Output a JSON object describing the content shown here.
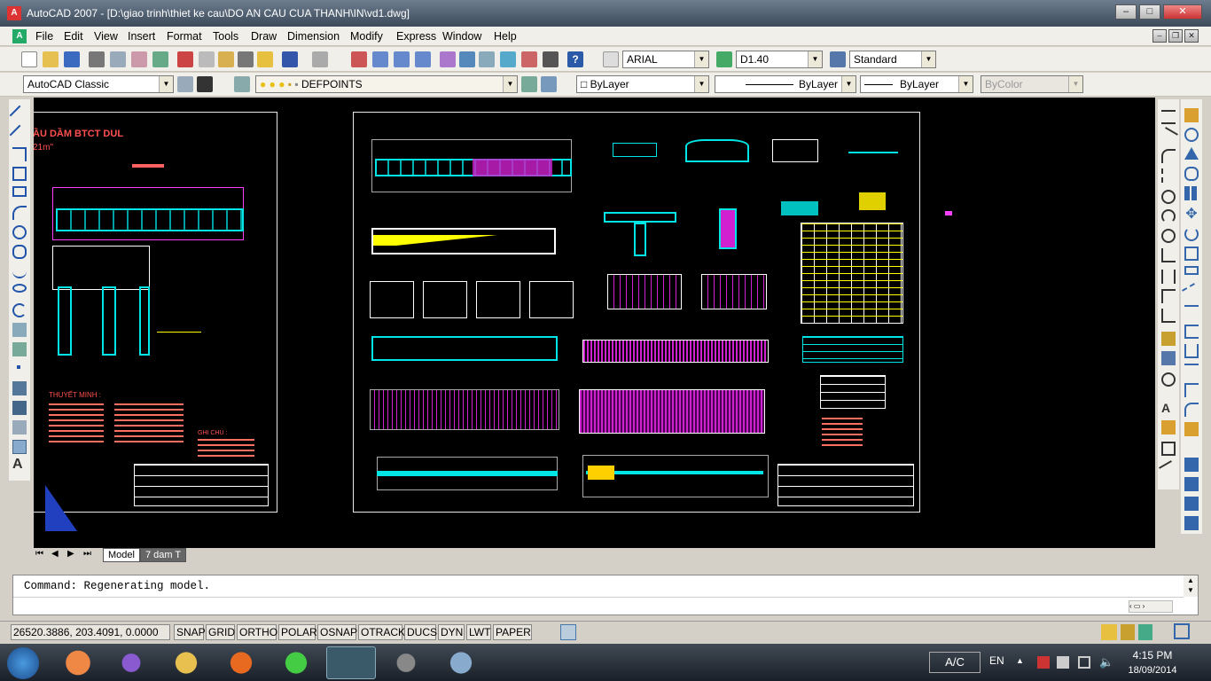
{
  "window": {
    "title": "AutoCAD 2007 - [D:\\giao trinh\\thiet ke cau\\DO AN CAU CUA THANH\\IN\\vd1.dwg]",
    "controls": {
      "minimize": "–",
      "maximize": "□",
      "close": "✕"
    }
  },
  "menu": [
    "File",
    "Edit",
    "View",
    "Insert",
    "Format",
    "Tools",
    "Draw",
    "Dimension",
    "Modify",
    "Express",
    "Window",
    "Help"
  ],
  "toolbar": {
    "text_style": "ARIAL",
    "dim_style": "D1.40",
    "table_style": "Standard",
    "workspace": "AutoCAD Classic",
    "layer": "DEFPOINTS",
    "color": "ByLayer",
    "linetype": "ByLayer",
    "lineweight": "ByLayer",
    "plotstyle": "ByColor"
  },
  "drawing": {
    "left_title": "ẦU DẦM BTCT DUL",
    "left_subtitle": "21m\"",
    "left_note1": "THUYẾT MINH :",
    "left_note2": "GHI CHÚ :"
  },
  "tabs": {
    "model": "Model",
    "layout": "7 dam T"
  },
  "command": {
    "line": "Command: Regenerating model."
  },
  "status": {
    "coords": "26520.3886, 203.4091, 0.0000",
    "buttons": [
      "SNAP",
      "GRID",
      "ORTHO",
      "POLAR",
      "OSNAP",
      "OTRACK",
      "DUCS",
      "DYN",
      "LWT",
      "PAPER"
    ]
  },
  "taskbar": {
    "lang_box": "A/C",
    "lang": "EN",
    "time": "4:15 PM",
    "date": "18/09/2014"
  },
  "colors": {
    "accent_cyan": "#00e5e5",
    "accent_magenta": "#ff00ff",
    "accent_yellow": "#ffff00",
    "accent_red": "#ff5050"
  }
}
